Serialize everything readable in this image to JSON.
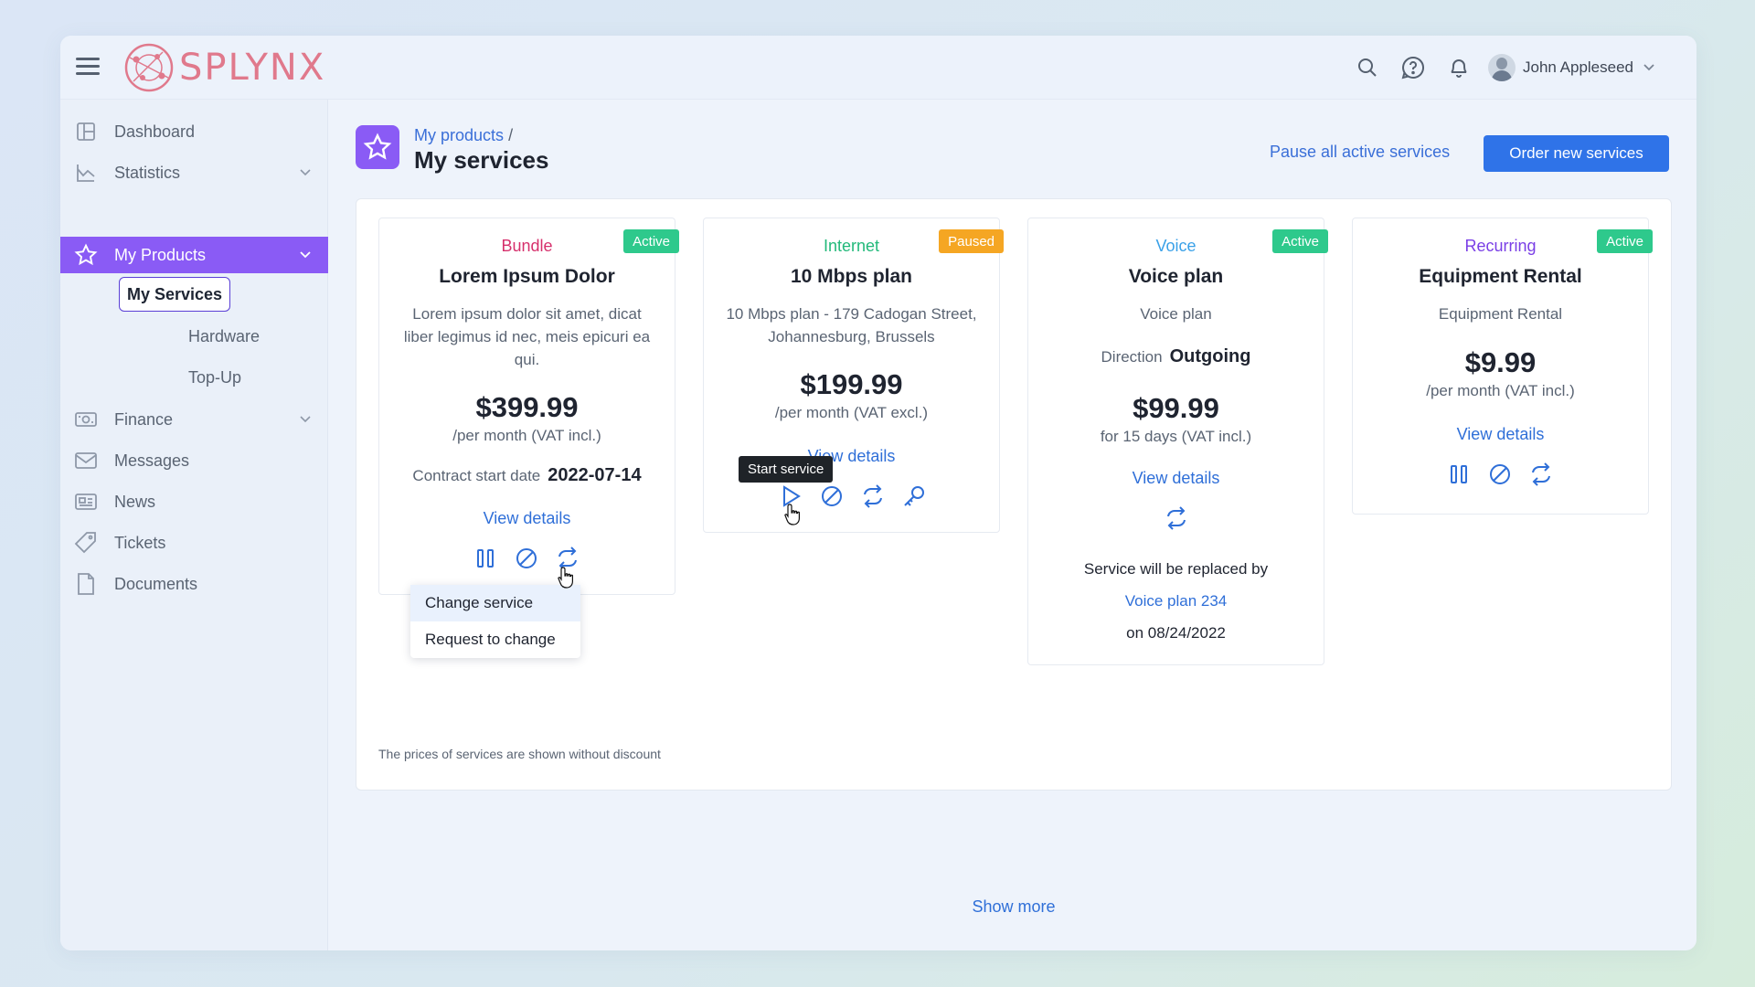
{
  "app": {
    "name": "SPLYNX"
  },
  "colors": {
    "accent": "#8a5bf5",
    "link": "#2f6fd8",
    "primary_button": "#2f73e8",
    "active": "#2ec98c",
    "paused": "#f5a623"
  },
  "header": {
    "user_name": "John Appleseed"
  },
  "sidebar": {
    "items": [
      {
        "label": "Dashboard",
        "icon": "dashboard-icon"
      },
      {
        "label": "Statistics",
        "icon": "statistics-icon"
      },
      {
        "label": "My Products",
        "icon": "star-icon"
      },
      {
        "label": "Finance",
        "icon": "finance-icon"
      },
      {
        "label": "Messages",
        "icon": "envelope-icon"
      },
      {
        "label": "News",
        "icon": "news-icon"
      },
      {
        "label": "Tickets",
        "icon": "ticket-icon"
      },
      {
        "label": "Documents",
        "icon": "document-icon"
      }
    ],
    "sub_items": [
      "My Services",
      "Hardware",
      "Top-Up"
    ]
  },
  "page": {
    "breadcrumb": "My products",
    "breadcrumb_sep": "/",
    "title": "My services",
    "pause_all": "Pause all active services",
    "order_new": "Order new services",
    "show_more": "Show more",
    "footnote": "The prices of services are shown without discount"
  },
  "cards": [
    {
      "category": "Bundle",
      "status": "Active",
      "name": "Lorem Ipsum Dolor",
      "desc": "Lorem ipsum dolor sit amet, dicat liber legimus id nec, meis epicuri ea qui.",
      "price": "$399.99",
      "period": "/per month (VAT incl.)",
      "meta_label": "Contract start date",
      "meta_value": "2022-07-14",
      "details": "View details"
    },
    {
      "category": "Internet",
      "status": "Paused",
      "name": "10 Mbps plan",
      "desc": "10 Mbps plan - 179 Cadogan Street, Johannesburg, Brussels",
      "price": "$199.99",
      "period": "/per month (VAT excl.)",
      "details": "View details"
    },
    {
      "category": "Voice",
      "status": "Active",
      "name": "Voice plan",
      "desc": "Voice plan",
      "meta_label": "Direction",
      "meta_value": "Outgoing",
      "price": "$99.99",
      "period": "for 15 days (VAT incl.)",
      "details": "View details",
      "replace_text": "Service will be replaced by",
      "replace_link": "Voice plan 234",
      "replace_date": "on 08/24/2022"
    },
    {
      "category": "Recurring",
      "status": "Active",
      "name": "Equipment Rental",
      "desc": "Equipment Rental",
      "price": "$9.99",
      "period": "/per month (VAT incl.)",
      "details": "View details"
    }
  ],
  "dropdown": {
    "items": [
      "Change service",
      "Request to change"
    ]
  },
  "tooltip": {
    "text": "Start service"
  }
}
